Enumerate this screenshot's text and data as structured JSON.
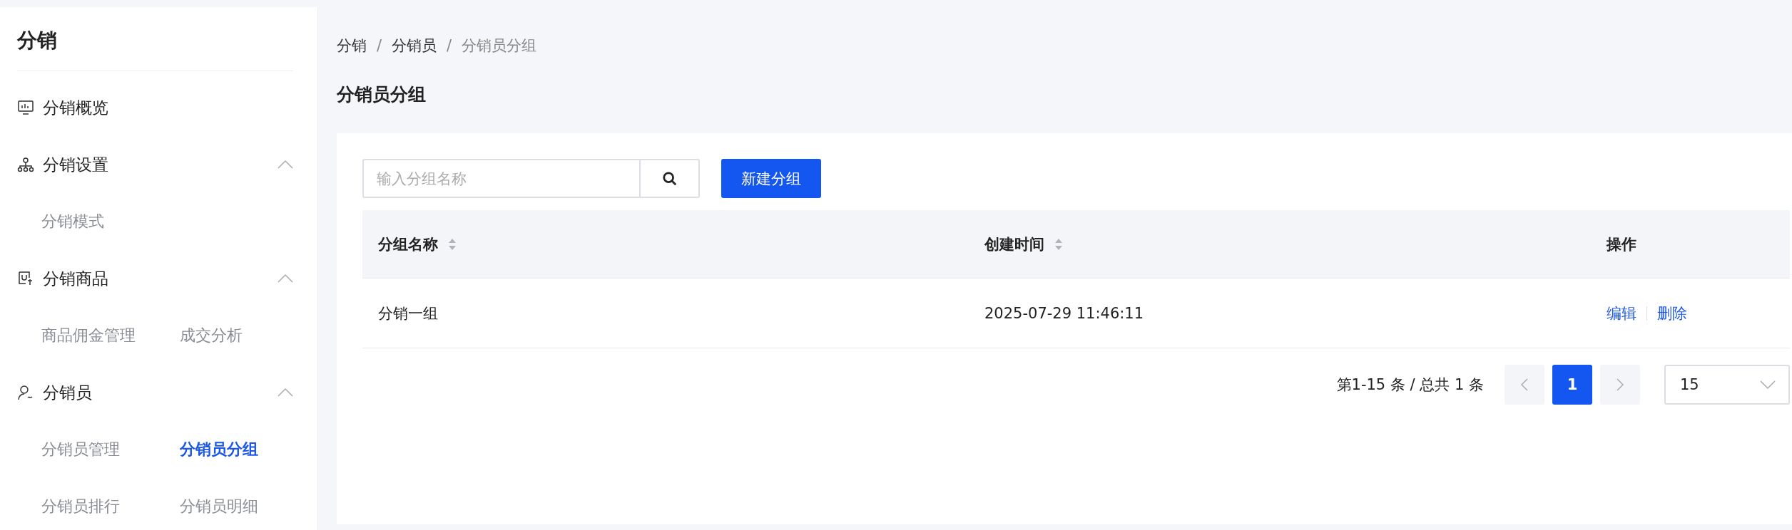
{
  "sidebar": {
    "title": "分销",
    "groups": [
      {
        "label": "分销概览"
      },
      {
        "label": "分销设置",
        "expanded": true,
        "items": [
          {
            "label": "分销模式",
            "selected": false
          }
        ]
      },
      {
        "label": "分销商品",
        "expanded": true,
        "items": [
          {
            "label": "商品佣金管理",
            "selected": false
          },
          {
            "label": "成交分析",
            "selected": false
          }
        ]
      },
      {
        "label": "分销员",
        "expanded": true,
        "items": [
          {
            "label": "分销员管理",
            "selected": false
          },
          {
            "label": "分销员分组",
            "selected": true
          },
          {
            "label": "分销员排行",
            "selected": false
          },
          {
            "label": "分销员明细",
            "selected": false
          }
        ]
      }
    ]
  },
  "breadcrumb": [
    {
      "kind": "link",
      "text": "分销"
    },
    {
      "kind": "separator",
      "text": "/"
    },
    {
      "kind": "link",
      "text": "分销员"
    },
    {
      "kind": "separator",
      "text": "/"
    },
    {
      "kind": "current",
      "text": "分销员分组"
    }
  ],
  "page_title": "分销员分组",
  "search": {
    "placeholder": "输入分组名称"
  },
  "new_button": "新建分组",
  "table": {
    "columns": [
      {
        "label": "分组名称",
        "sortable": true
      },
      {
        "label": "创建时间",
        "sortable": true
      },
      {
        "label": "操作",
        "sortable": false
      }
    ],
    "rows": [
      {
        "name": "分销一组",
        "created": "2025-07-29 11:46:11",
        "actions": [
          "编辑",
          "删除"
        ]
      }
    ]
  },
  "pagination": {
    "summary": "第1-15 条 / 总共 1 条",
    "pages": [
      {
        "label": "1",
        "selected": true
      }
    ],
    "page_size": "15"
  }
}
